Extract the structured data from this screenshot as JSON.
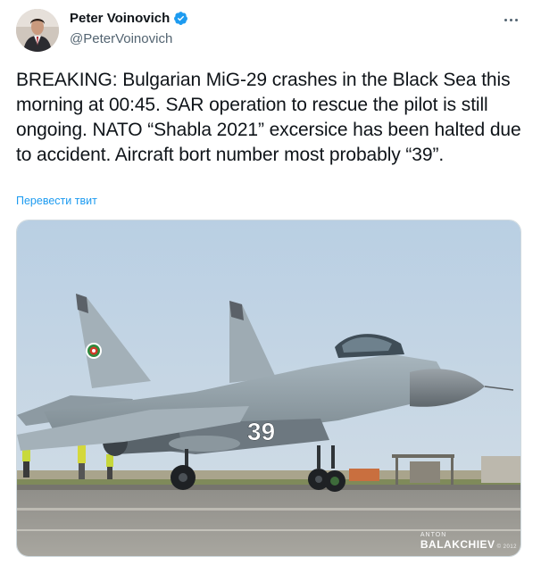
{
  "tweet": {
    "author_name": "Peter Voinovich",
    "author_handle": "@PeterVoinovich",
    "verified": true,
    "more_icon": "more-horizontal-icon",
    "text": "BREAKING: Bulgarian MiG-29 crashes in the Black Sea this morning at 00:45. SAR operation to rescue the pilot is still ongoing. NATO “Shabla 2021” excersice has been halted due to accident. Aircraft bort number most probably “39”.",
    "translate_label": "Перевести твит"
  },
  "media": {
    "aircraft_number": "39",
    "watermark_first": "ANTON",
    "watermark_last": "BALAKCHIEV",
    "watermark_year": "© 2012"
  },
  "colors": {
    "link": "#1d9bf0",
    "verified_badge": "#1d9bf0",
    "secondary_text": "#536471",
    "primary_text": "#0f1419"
  }
}
